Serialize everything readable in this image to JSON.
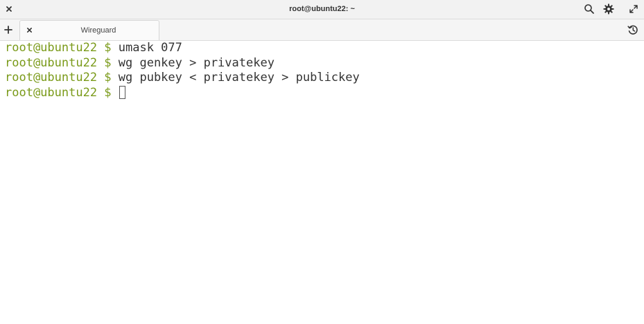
{
  "window": {
    "title": "root@ubuntu22: ~"
  },
  "tabs": [
    {
      "label": "Wireguard"
    }
  ],
  "terminal": {
    "lines": [
      {
        "prompt": "root@ubuntu22 $ ",
        "command": "umask 077"
      },
      {
        "prompt": "root@ubuntu22 $ ",
        "command": "wg genkey > privatekey"
      },
      {
        "prompt": "root@ubuntu22 $ ",
        "command": "wg pubkey < privatekey > publickey"
      },
      {
        "prompt": "root@ubuntu22 $ ",
        "command": ""
      }
    ]
  },
  "colors": {
    "prompt": "#7a9a19",
    "text": "#333333",
    "background": "#ffffff",
    "titlebar": "#f2f2f2"
  },
  "icons": {
    "close": "close-icon",
    "search": "search-icon",
    "settings": "gear-icon",
    "maximize": "maximize-icon",
    "new_tab": "plus-icon",
    "tab_close": "close-icon",
    "history": "history-icon"
  }
}
